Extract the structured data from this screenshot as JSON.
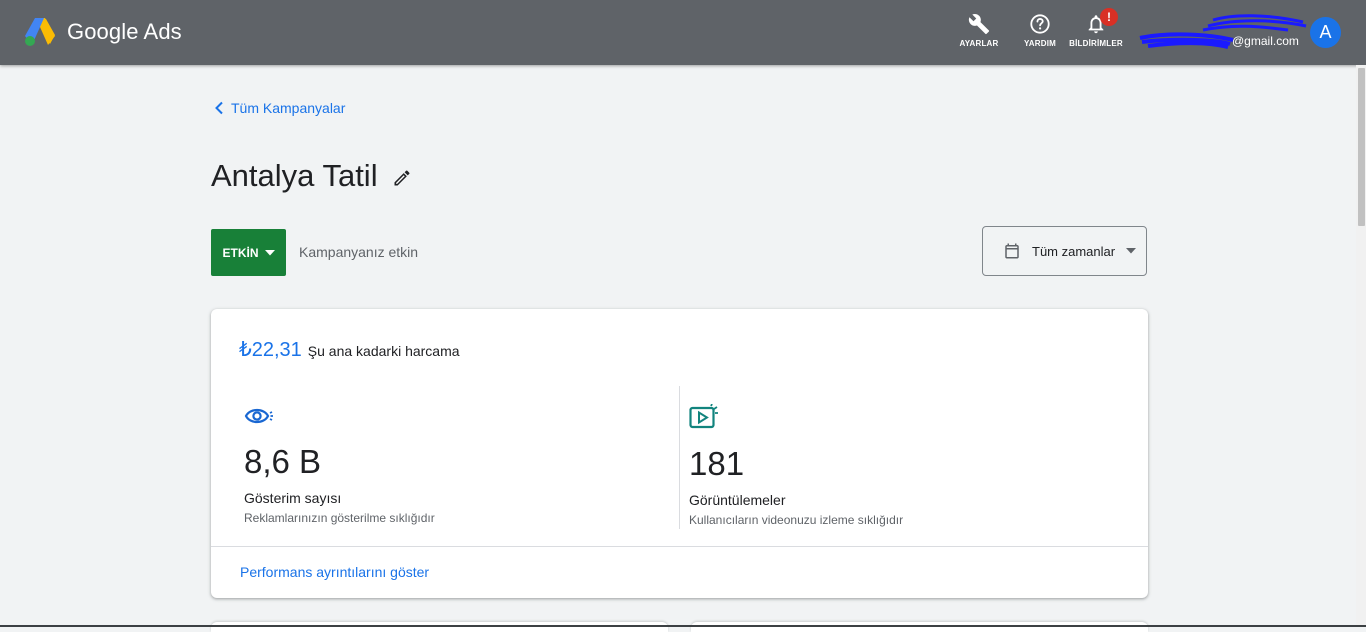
{
  "header": {
    "brand": "Google Ads",
    "tools": [
      {
        "label": "AYARLAR",
        "icon": "wrench-icon"
      },
      {
        "label": "YARDIM",
        "icon": "help-icon"
      },
      {
        "label": "BİLDİRİMLER",
        "icon": "bell-icon",
        "badge": "!"
      }
    ],
    "account_email": "@gmail.com",
    "avatar_letter": "A"
  },
  "nav": {
    "back_label": "Tüm Kampanyalar"
  },
  "campaign": {
    "title": "Antalya Tatil",
    "status_label": "ETKİN",
    "status_text": "Kampanyanız etkin",
    "date_range": "Tüm zamanlar"
  },
  "summary": {
    "spend_amount": "₺22,31",
    "spend_label": "Şu ana kadarki harcama",
    "metrics": [
      {
        "icon": "eye-icon",
        "value": "8,6 B",
        "title": "Gösterim sayısı",
        "subtitle": "Reklamlarınızın gösterilme sıklığıdır"
      },
      {
        "icon": "video-play-icon",
        "value": "181",
        "title": "Görüntülemeler",
        "subtitle": "Kullanıcıların videonuzu izleme sıklığıdır"
      }
    ],
    "details_link": "Performans ayrıntılarını göster"
  },
  "colors": {
    "topbar": "#5f6368",
    "accent": "#1a73e8",
    "status_green": "#188038",
    "badge_red": "#d93025"
  }
}
